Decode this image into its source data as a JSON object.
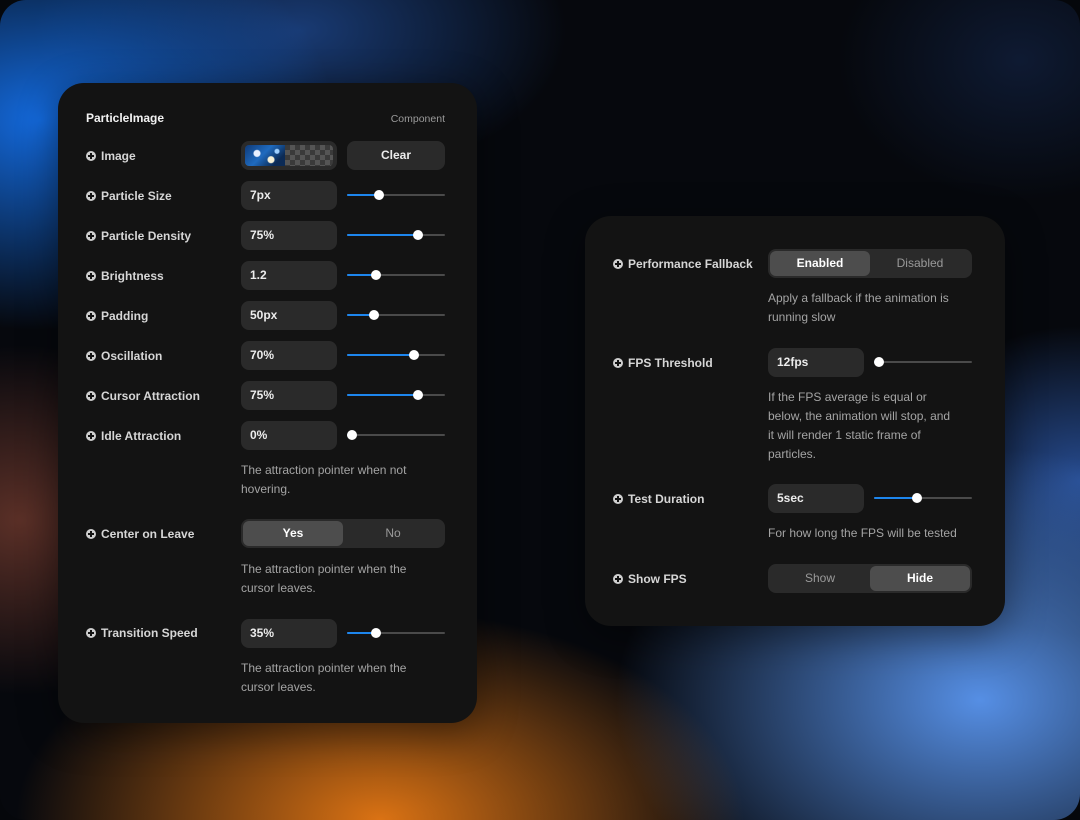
{
  "left_panel": {
    "title": "ParticleImage",
    "badge": "Component",
    "image": {
      "label": "Image",
      "clear_label": "Clear"
    },
    "rows": [
      {
        "label": "Particle Size",
        "value": "7px",
        "level": 0.33
      },
      {
        "label": "Particle Density",
        "value": "75%",
        "level": 0.72
      },
      {
        "label": "Brightness",
        "value": "1.2",
        "level": 0.3
      },
      {
        "label": "Padding",
        "value": "50px",
        "level": 0.28
      },
      {
        "label": "Oscillation",
        "value": "70%",
        "level": 0.68
      },
      {
        "label": "Cursor Attraction",
        "value": "75%",
        "level": 0.72
      },
      {
        "label": "Idle Attraction",
        "value": "0%",
        "level": 0.05
      }
    ],
    "idle_help": [
      "The attraction pointer when not",
      "hovering."
    ],
    "center_on_leave": {
      "label": "Center on Leave",
      "options": [
        "Yes",
        "No"
      ],
      "selected": "Yes",
      "help": [
        "The attraction pointer when the",
        "cursor leaves."
      ]
    },
    "transition_speed": {
      "label": "Transition Speed",
      "value": "35%",
      "level": 0.3,
      "help": [
        "The attraction pointer when the",
        "cursor leaves."
      ]
    }
  },
  "right_panel": {
    "performance_fallback": {
      "label": "Performance Fallback",
      "options": [
        "Enabled",
        "Disabled"
      ],
      "selected": "Enabled",
      "help": [
        "Apply a fallback if the animation is",
        "running slow"
      ]
    },
    "fps_threshold": {
      "label": "FPS Threshold",
      "value": "12fps",
      "level": 0.05,
      "help": [
        "If the FPS average is equal or",
        "below, the animation will stop, and",
        "it will render 1 static frame of",
        "particles."
      ]
    },
    "test_duration": {
      "label": "Test Duration",
      "value": "5sec",
      "level": 0.44,
      "help": [
        "For how long the FPS will be tested"
      ]
    },
    "show_fps": {
      "label": "Show FPS",
      "options": [
        "Show",
        "Hide"
      ],
      "selected": "Hide"
    }
  },
  "colors": {
    "panel": "#131313",
    "control": "#2a2a2a",
    "accent": "#1d86ee",
    "segment_active": "#4d4d4d"
  }
}
